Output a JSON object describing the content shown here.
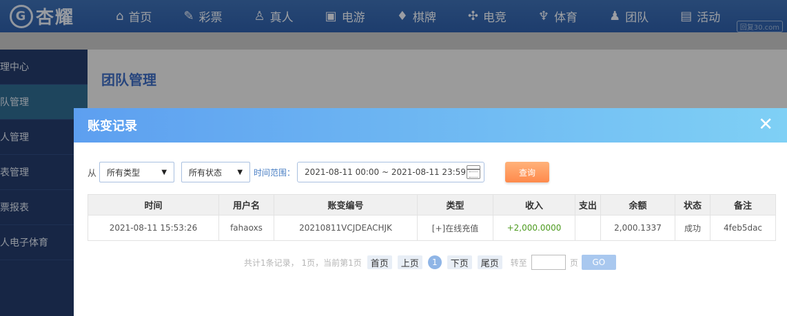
{
  "logo": {
    "mark": "G",
    "text": "杏耀"
  },
  "nav": [
    {
      "icon": "home-icon",
      "glyph": "⌂",
      "label": "首页"
    },
    {
      "icon": "lottery-icon",
      "glyph": "✎",
      "label": "彩票"
    },
    {
      "icon": "live-dealer-icon",
      "glyph": "♙",
      "label": "真人"
    },
    {
      "icon": "slot-machine-icon",
      "glyph": "▣",
      "label": "电游"
    },
    {
      "icon": "chess-card-icon",
      "glyph": "♦",
      "label": "棋牌"
    },
    {
      "icon": "gamepad-icon",
      "glyph": "✣",
      "label": "电竞"
    },
    {
      "icon": "trophy-icon",
      "glyph": "♆",
      "label": "体育"
    },
    {
      "icon": "team-icon",
      "glyph": "♟",
      "label": "团队"
    },
    {
      "icon": "gift-icon",
      "glyph": "▤",
      "label": "活动"
    }
  ],
  "watermark": "回复30.com",
  "sidebar": [
    {
      "label": "理中心",
      "active": false
    },
    {
      "label": "队管理",
      "active": true
    },
    {
      "label": "人管理",
      "active": false
    },
    {
      "label": "表管理",
      "active": false
    },
    {
      "label": "票报表",
      "active": false
    },
    {
      "label": "人电子体育",
      "active": false
    }
  ],
  "main_title": "团队管理",
  "modal": {
    "title": "账变记录",
    "close_glyph": "✕",
    "filters": {
      "from_label": "从",
      "type_select": "所有类型",
      "status_select": "所有状态",
      "range_label": "时间范围：",
      "date_range": "2021-08-11 00:00 ~ 2021-08-11 23:59",
      "query_button": "查询"
    },
    "table": {
      "headers": [
        "时间",
        "用户名",
        "账变编号",
        "类型",
        "收入",
        "支出",
        "余额",
        "状态",
        "备注"
      ],
      "rows": [
        [
          "2021-08-11 15:53:26",
          "fahaoxs",
          "20210811VCJDEACHJK",
          "[+]在线充值",
          "+2,000.0000",
          "",
          "2,000.1337",
          "成功",
          "4feb5dac"
        ]
      ]
    },
    "pager": {
      "summary": "共计1条记录， 1页，当前第1页",
      "first": "首页",
      "prev": "上页",
      "current": "1",
      "next": "下页",
      "last": "尾页",
      "goto_label": "转至",
      "page_unit": "页",
      "go": "GO"
    }
  }
}
